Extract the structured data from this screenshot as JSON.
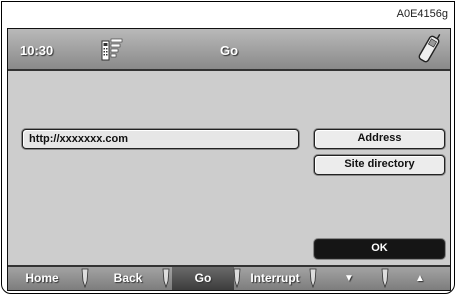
{
  "ref_code": "A0E4156g",
  "status": {
    "time": "10:30",
    "title": "Go"
  },
  "url_field": {
    "value": "http://xxxxxxx.com"
  },
  "buttons": {
    "address": "Address",
    "site_directory": "Site directory",
    "ok": "OK"
  },
  "nav": {
    "home": "Home",
    "back": "Back",
    "go": "Go",
    "interrupt": "Interrupt",
    "down": "▼",
    "up": "▲",
    "active": "Go"
  },
  "icons": {
    "signal": "signal-strength-icon",
    "phone": "phone-icon"
  }
}
